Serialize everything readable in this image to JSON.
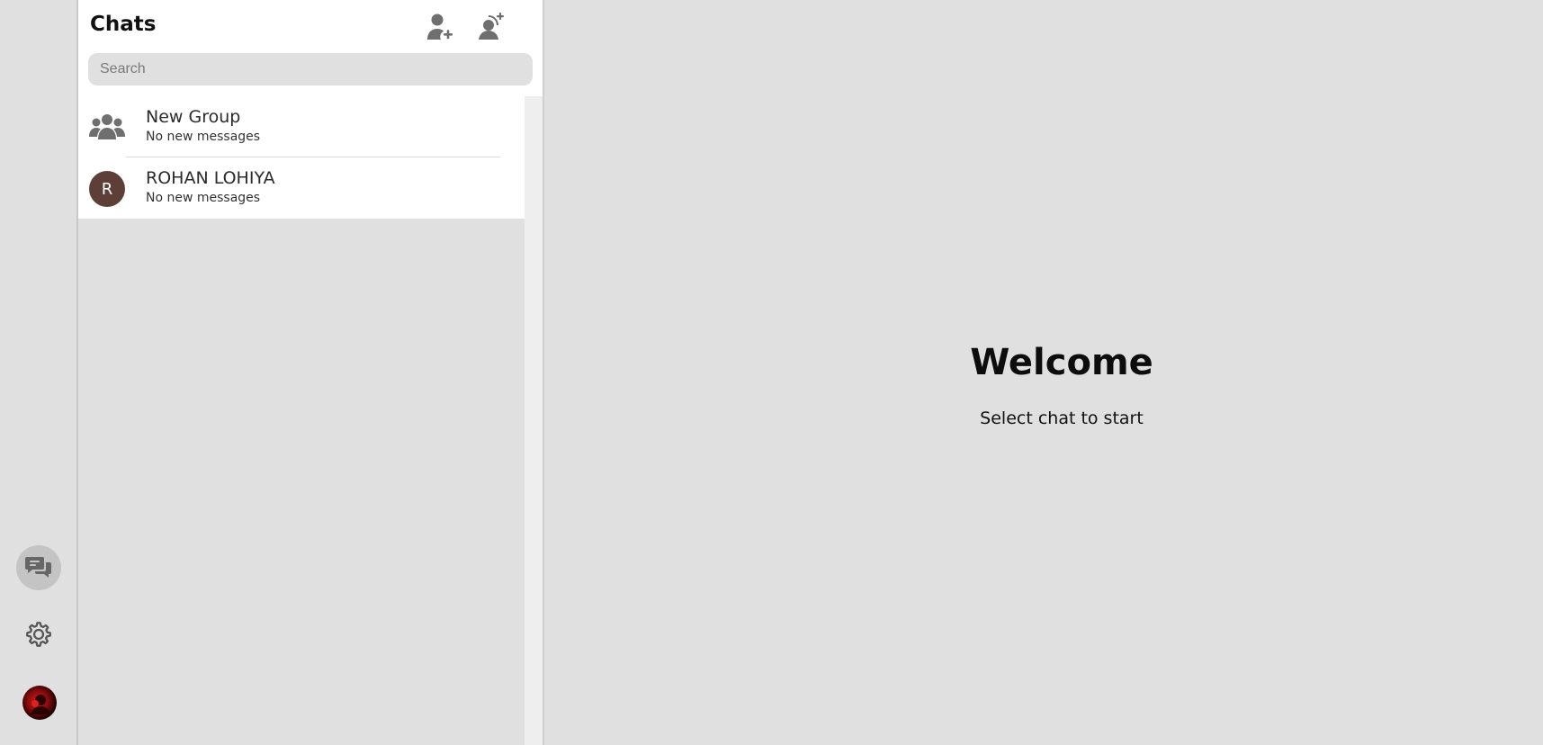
{
  "rail": {
    "chats_icon": "chat-bubbles-icon",
    "settings_icon": "gear-icon",
    "avatar_icon": "user-avatar"
  },
  "panel": {
    "title": "Chats",
    "add_user_icon": "add-user-icon",
    "add_contact_icon": "add-contact-icon",
    "search": {
      "placeholder": "Search",
      "value": ""
    }
  },
  "chats": [
    {
      "name": "New Group",
      "subtitle": "No new messages",
      "icon": "group-icon"
    },
    {
      "name": "ROHAN LOHIYA",
      "subtitle": "No new messages",
      "avatar_letter": "R",
      "avatar_color": "#5d3f38"
    }
  ],
  "main": {
    "title": "Welcome",
    "subtitle": "Select chat to start"
  },
  "colors": {
    "background": "#e0e0e0",
    "panel": "#ffffff",
    "icon": "#6f6f6f"
  }
}
